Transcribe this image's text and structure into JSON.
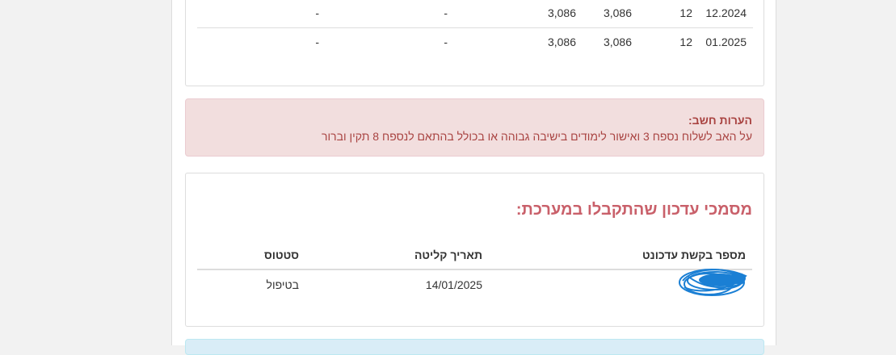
{
  "payments_table": {
    "rows": [
      {
        "date": "12.2024",
        "months": "12",
        "amount_a": "3,086",
        "amount_b": "3,086",
        "col_c": "-",
        "col_d": "-"
      },
      {
        "date": "01.2025",
        "months": "12",
        "amount_a": "3,086",
        "amount_b": "3,086",
        "col_c": "-",
        "col_d": "-"
      }
    ]
  },
  "alert": {
    "title": "הערות חשב:",
    "body": "על האב לשלוח נספח 3 ואישור לימודים בישיבה גבוהה או בכולל בהתאם לנספח 8 תקין וברור"
  },
  "documents": {
    "title": "מסמכי עדכון שהתקבלו במערכת:",
    "columns": {
      "request_number": "מספר בקשת עדכונט",
      "received_date": "תאריך קליטה",
      "status": "סטטוס"
    },
    "rows": [
      {
        "received_date": "14/01/2025",
        "status": "בטיפול"
      }
    ]
  },
  "colors": {
    "alert_bg": "#f2dede",
    "alert_text": "#a94442",
    "section_title": "#c9606a",
    "info_bg": "#d9edf7"
  }
}
